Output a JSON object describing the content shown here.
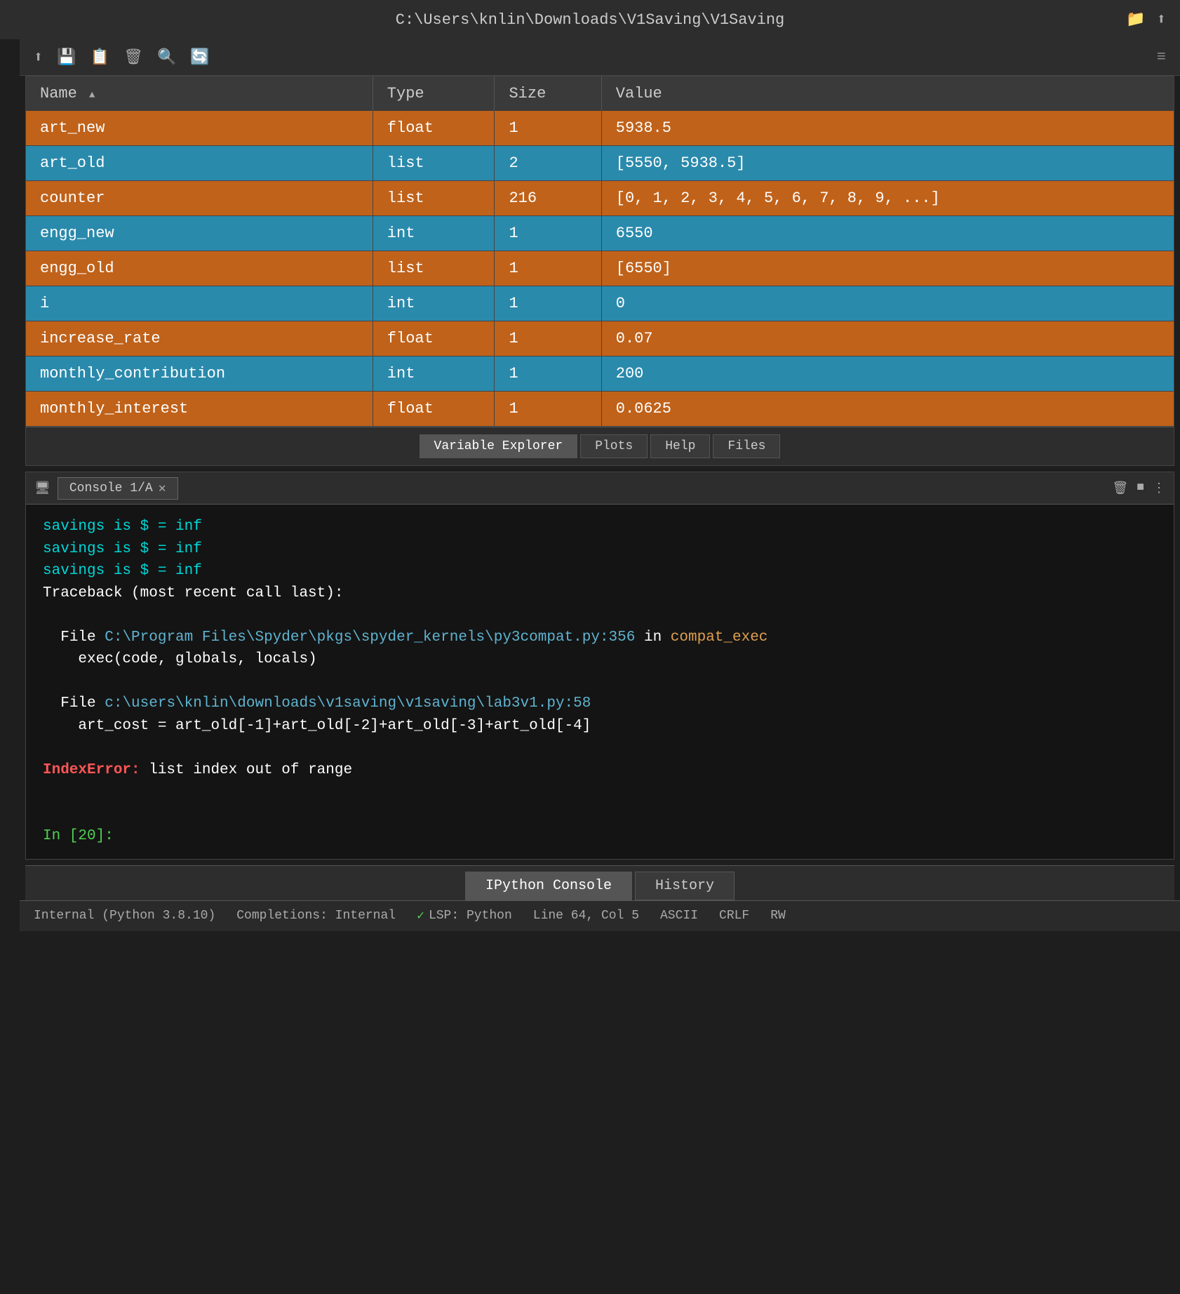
{
  "titleBar": {
    "path": "C:\\Users\\knlin\\Downloads\\V1Saving\\V1Saving",
    "icon1": "📁",
    "icon2": "⬆"
  },
  "toolbar": {
    "icons": [
      "⬆",
      "💾",
      "📋",
      "🗑",
      "🔍",
      "🔄"
    ]
  },
  "table": {
    "columns": [
      "Name",
      "Type",
      "Size",
      "Value"
    ],
    "rows": [
      {
        "name": "art_new",
        "type": "float",
        "size": "1",
        "value": "5938.5",
        "color": "orange"
      },
      {
        "name": "art_old",
        "type": "list",
        "size": "2",
        "value": "[5550, 5938.5]",
        "color": "blue"
      },
      {
        "name": "counter",
        "type": "list",
        "size": "216",
        "value": "[0, 1, 2, 3, 4, 5, 6, 7, 8, 9, ...]",
        "color": "orange"
      },
      {
        "name": "engg_new",
        "type": "int",
        "size": "1",
        "value": "6550",
        "color": "blue"
      },
      {
        "name": "engg_old",
        "type": "list",
        "size": "1",
        "value": "[6550]",
        "color": "orange"
      },
      {
        "name": "i",
        "type": "int",
        "size": "1",
        "value": "0",
        "color": "blue"
      },
      {
        "name": "increase_rate",
        "type": "float",
        "size": "1",
        "value": "0.07",
        "color": "orange"
      },
      {
        "name": "monthly_contribution",
        "type": "int",
        "size": "1",
        "value": "200",
        "color": "blue"
      },
      {
        "name": "monthly_interest",
        "type": "float",
        "size": "1",
        "value": "0.0625",
        "color": "orange"
      }
    ]
  },
  "panelTabs": {
    "tabs": [
      "Variable Explorer",
      "Plots",
      "Help",
      "Files"
    ],
    "active": "Variable Explorer"
  },
  "console": {
    "tabLabel": "Console 1/A",
    "output": {
      "line1": "savings is $ = inf",
      "line2": "savings is $ = inf",
      "line3": "savings is $ = inf",
      "traceback_header": "Traceback (most recent call last):",
      "file1_prefix": "File ",
      "file1_path": "C:\\Program Files\\Spyder\\pkgs\\spyder_kernels\\py3compat.py:356",
      "file1_suffix": " in compat_exec",
      "file1_code": "exec(code, globals, locals)",
      "file2_prefix": "File ",
      "file2_path": "c:\\users\\knlin\\downloads\\v1saving\\v1saving\\lab3v1.py:58",
      "file2_code": "art_cost = art_old[-1]+art_old[-2]+art_old[-3]+art_old[-4]",
      "error_type": "IndexError:",
      "error_msg": " list index out of range",
      "prompt": "In [20]:"
    }
  },
  "bottomTabs": {
    "tabs": [
      "IPython Console",
      "History"
    ],
    "active": "IPython Console"
  },
  "statusBar": {
    "interpreter": "Internal (Python 3.8.10)",
    "completions": "Completions: Internal",
    "lsp": "LSP: Python",
    "position": "Line 64, Col 5",
    "encoding": "ASCII",
    "eol": "CRLF",
    "permission": "RW"
  }
}
